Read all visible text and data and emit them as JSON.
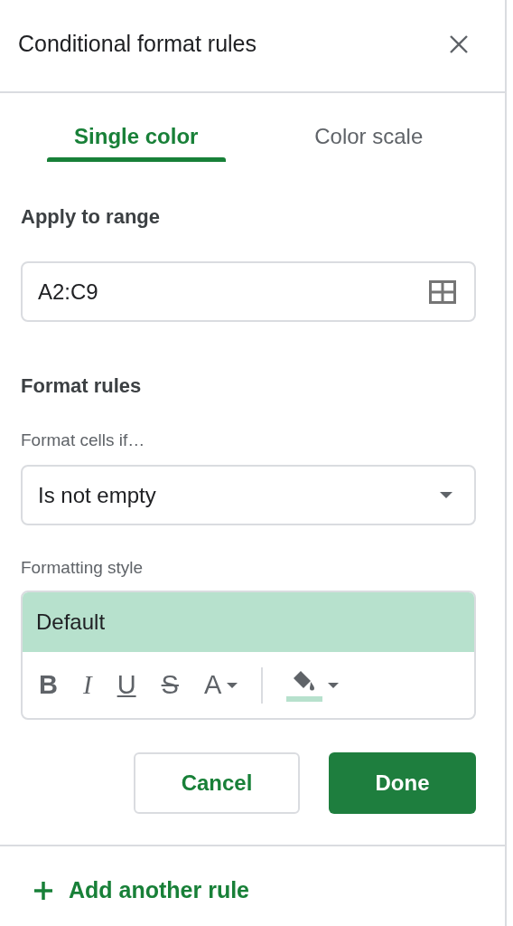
{
  "panel": {
    "title": "Conditional format rules"
  },
  "tabs": [
    {
      "label": "Single color",
      "selected": true
    },
    {
      "label": "Color scale",
      "selected": false
    }
  ],
  "range": {
    "heading": "Apply to range",
    "value": "A2:C9"
  },
  "rules": {
    "heading": "Format rules",
    "condition_label": "Format cells if…",
    "condition_value": "Is not empty",
    "style_label": "Formatting style",
    "preview": {
      "text": "Default",
      "color": "#b7e1cd"
    },
    "toolbar": [
      {
        "kind": "bold",
        "label": "B"
      },
      {
        "kind": "italic",
        "label": "I"
      },
      {
        "kind": "underline",
        "label": "U"
      },
      {
        "kind": "strikethrough",
        "label": "S"
      },
      {
        "kind": "text_color",
        "label": "A"
      },
      {
        "kind": "fill_color",
        "color": "#b7e1cd"
      }
    ]
  },
  "buttons": [
    {
      "label": "Cancel",
      "kind": "secondary"
    },
    {
      "label": "Done",
      "kind": "primary"
    }
  ],
  "add_rule": {
    "label": "Add another rule"
  }
}
